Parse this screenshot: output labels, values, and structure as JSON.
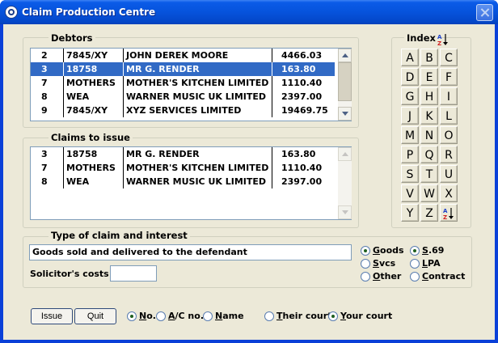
{
  "window": {
    "title": "Claim Production Centre"
  },
  "debtors": {
    "label": "Debtors",
    "rows": [
      {
        "no": "2",
        "ac": "7845/XY",
        "name": "JOHN DEREK MOORE",
        "amount": "4466.03",
        "selected": false
      },
      {
        "no": "3",
        "ac": "18758",
        "name": "MR G. RENDER",
        "amount": "163.80",
        "selected": true
      },
      {
        "no": "7",
        "ac": "MOTHERS",
        "name": "MOTHER'S KITCHEN LIMITED",
        "amount": "1110.40",
        "selected": false
      },
      {
        "no": "8",
        "ac": "WEA",
        "name": "WARNER MUSIC UK LIMITED",
        "amount": "2397.00",
        "selected": false
      },
      {
        "no": "9",
        "ac": "7845/XY",
        "name": "XYZ SERVICES LIMITED",
        "amount": "19469.75",
        "selected": false
      }
    ]
  },
  "claims": {
    "label": "Claims to issue",
    "rows": [
      {
        "no": "3",
        "ac": "18758",
        "name": "MR G. RENDER",
        "amount": "163.80"
      },
      {
        "no": "7",
        "ac": "MOTHERS",
        "name": "MOTHER'S KITCHEN LIMITED",
        "amount": "1110.40"
      },
      {
        "no": "8",
        "ac": "WEA",
        "name": "WARNER MUSIC UK LIMITED",
        "amount": "2397.00"
      }
    ]
  },
  "index": {
    "label": "Index",
    "sort_icon": "sort-az-icon",
    "letters": [
      "A",
      "B",
      "C",
      "D",
      "E",
      "F",
      "G",
      "H",
      "I",
      "J",
      "K",
      "L",
      "M",
      "N",
      "O",
      "P",
      "Q",
      "R",
      "S",
      "T",
      "U",
      "V",
      "W",
      "X",
      "Y",
      "Z"
    ]
  },
  "claim_type": {
    "label": "Type of claim and interest",
    "description": "Goods sold and delivered to the defendant",
    "solicitor_costs_label": "Solicitor's costs",
    "solicitor_costs_value": "",
    "type_options": [
      {
        "label": "Goods",
        "checked": true
      },
      {
        "label": "Svcs",
        "checked": false
      },
      {
        "label": "Other",
        "checked": false
      }
    ],
    "interest_options": [
      {
        "label": "S.69",
        "checked": true
      },
      {
        "label": "LPA",
        "checked": false
      },
      {
        "label": "Contract",
        "checked": false
      }
    ]
  },
  "bottom": {
    "issue_label": "Issue",
    "quit_label": "Quit",
    "sort_options": [
      {
        "label": "No.",
        "checked": true
      },
      {
        "label": "A/C no.",
        "checked": false
      },
      {
        "label": "Name",
        "checked": false
      }
    ],
    "court_options": [
      {
        "label": "Their court",
        "checked": false
      },
      {
        "label": "Your court",
        "checked": true
      }
    ]
  },
  "colors": {
    "selection": "#316ac5",
    "titlebar": "#0653dc",
    "face": "#ece9d8"
  }
}
